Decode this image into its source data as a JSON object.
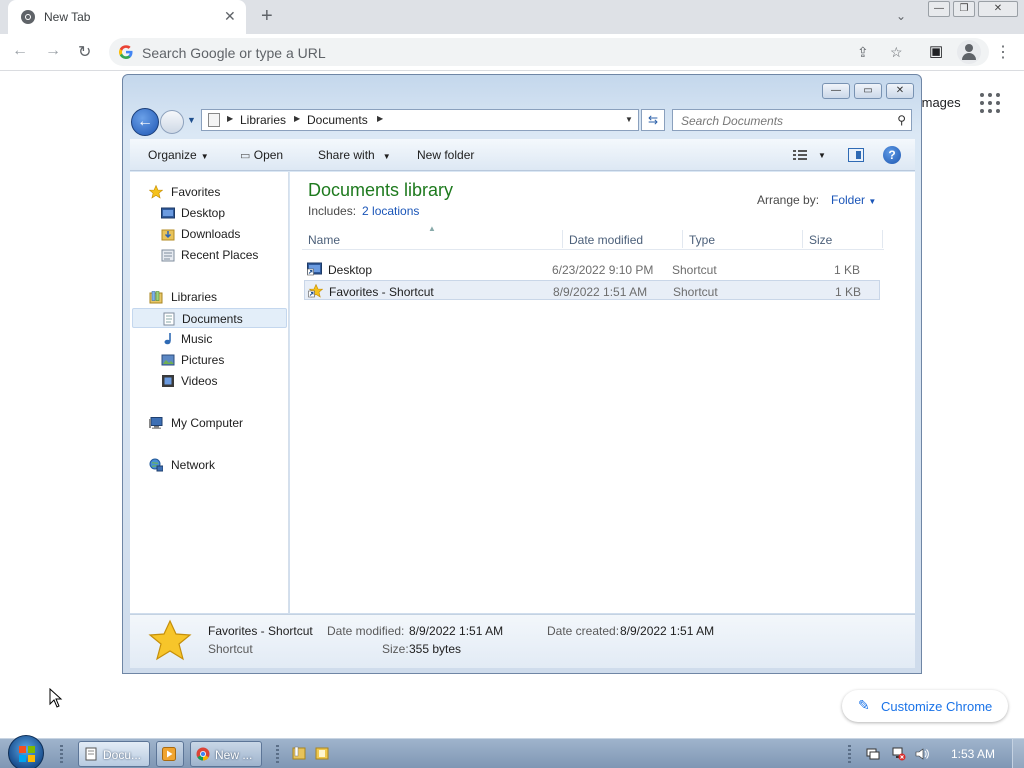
{
  "chrome": {
    "tab_title": "New Tab",
    "omnibox_placeholder": "Search Google or type a URL",
    "images_link": "Images",
    "customize_label": "Customize Chrome"
  },
  "explorer": {
    "breadcrumb": [
      "Libraries",
      "Documents"
    ],
    "search_placeholder": "Search Documents",
    "commands": {
      "organize": "Organize",
      "open": "Open",
      "share_with": "Share with",
      "new_folder": "New folder"
    },
    "nav": {
      "favorites": "Favorites",
      "desktop": "Desktop",
      "downloads": "Downloads",
      "recent_places": "Recent Places",
      "libraries": "Libraries",
      "documents": "Documents",
      "music": "Music",
      "pictures": "Pictures",
      "videos": "Videos",
      "my_computer": "My Computer",
      "network": "Network"
    },
    "library": {
      "title": "Documents library",
      "includes_label": "Includes:",
      "includes_link": "2 locations",
      "arrange_label": "Arrange by:",
      "arrange_value": "Folder"
    },
    "columns": [
      "Name",
      "Date modified",
      "Type",
      "Size"
    ],
    "files": [
      {
        "name": "Desktop",
        "date": "6/23/2022 9:10 PM",
        "type": "Shortcut",
        "size": "1 KB"
      },
      {
        "name": "Favorites - Shortcut",
        "date": "8/9/2022 1:51 AM",
        "type": "Shortcut",
        "size": "1 KB"
      }
    ],
    "details": {
      "name": "Favorites - Shortcut",
      "type": "Shortcut",
      "date_modified_label": "Date modified:",
      "date_modified": "8/9/2022 1:51 AM",
      "date_created_label": "Date created:",
      "date_created": "8/9/2022 1:51 AM",
      "size_label": "Size:",
      "size": "355 bytes"
    }
  },
  "taskbar": {
    "explorer_label": "Docu...",
    "chrome_label": "New ...",
    "clock": "1:53 AM"
  },
  "colors": {
    "library_title": "#1e7a1e",
    "link_blue": "#1a55b8",
    "chrome_blue": "#1a73e8"
  }
}
